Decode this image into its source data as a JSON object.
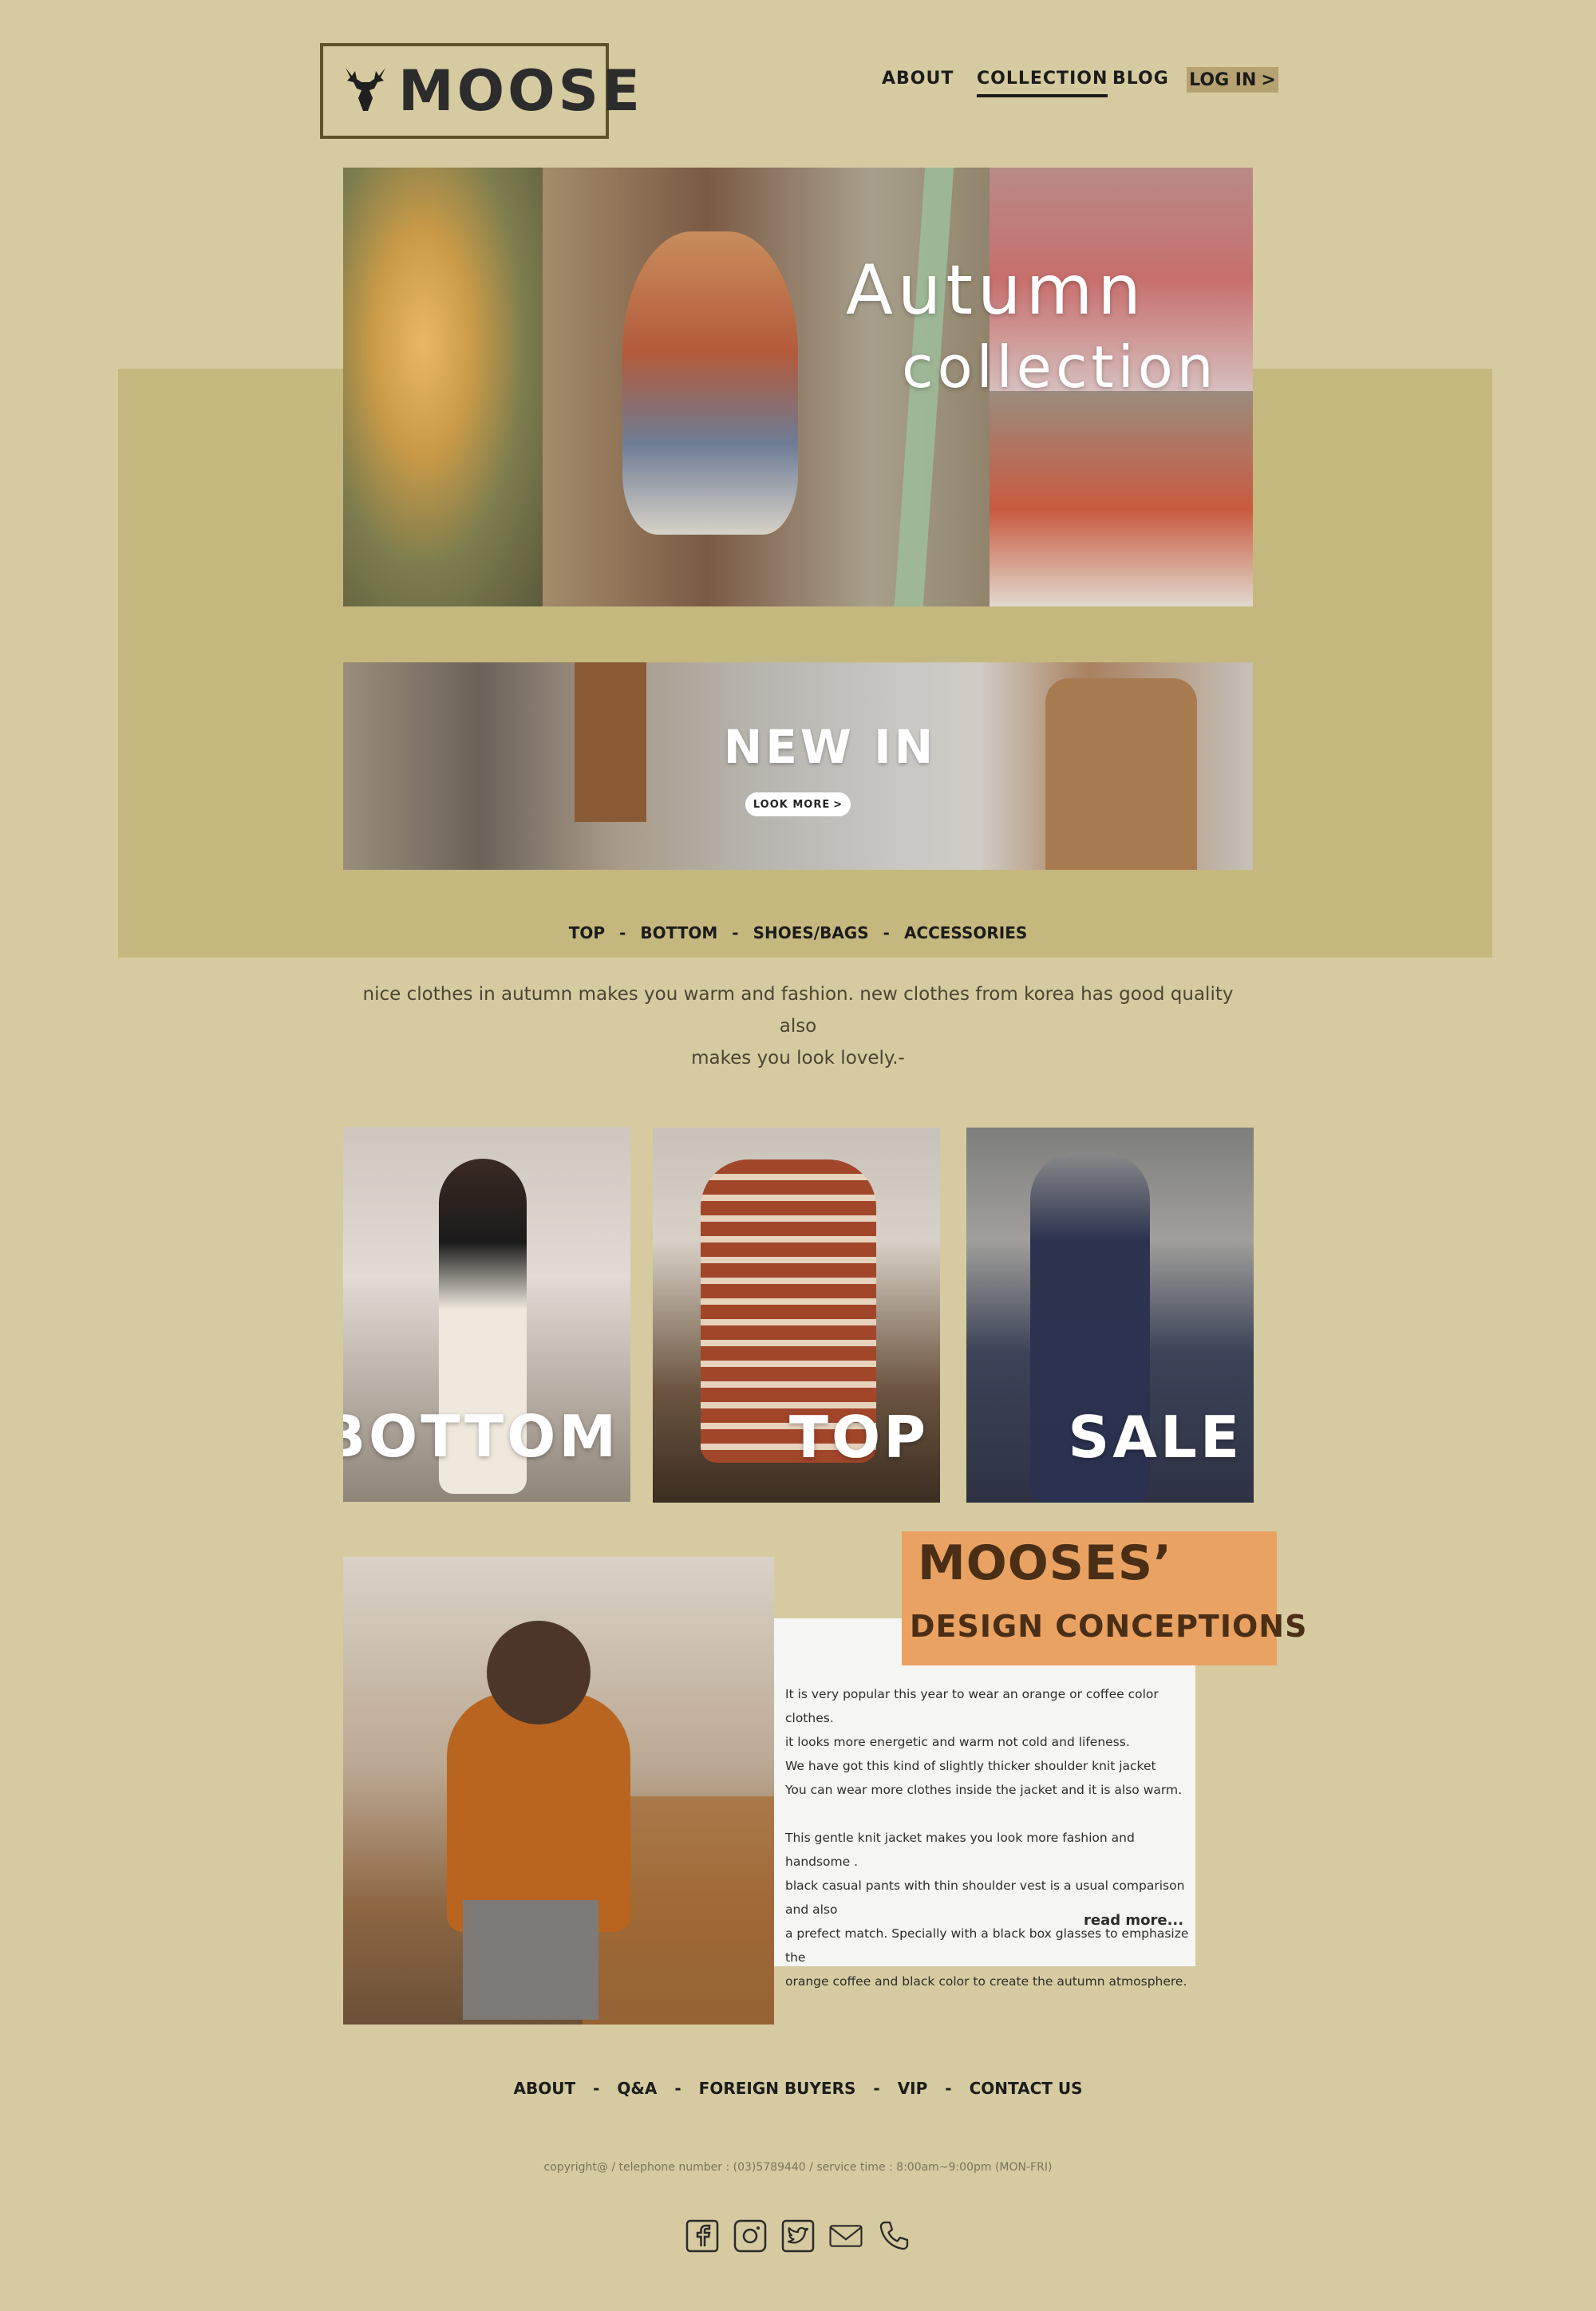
{
  "brand": {
    "name": "MOOSE",
    "logo_icon": "moose-head-icon"
  },
  "nav": {
    "items": [
      {
        "label": "ABOUT"
      },
      {
        "label": "COLLECTION",
        "active": true
      },
      {
        "label": "BLOG"
      }
    ],
    "login": {
      "label": "LOG IN",
      "icon": ">"
    }
  },
  "hero": {
    "line1": "Autumn",
    "line2": "collection"
  },
  "new_in": {
    "title": "NEW  IN",
    "button": "LOOK  MORE",
    "button_icon": ">"
  },
  "categories": {
    "items": [
      "TOP",
      "BOTTOM",
      "SHOES/BAGS",
      "ACCESSORIES"
    ],
    "separator": "-"
  },
  "intro": {
    "line1": "nice clothes in autumn makes you warm and fashion. new clothes from korea has good quality  also",
    "line2": "makes you look lovely.-"
  },
  "tiles": [
    {
      "label": "BOTTOM"
    },
    {
      "label": "TOP"
    },
    {
      "label": "SALE"
    }
  ],
  "concept": {
    "title1": "MOOSES’",
    "title2": "DESIGN  CONCEPTIONS",
    "paragraph1": [
      "It is very popular this year to wear an orange or coffee color clothes.",
      "it looks more energetic and warm not cold and lifeness.",
      "We have got this kind of slightly thicker shoulder knit jacket",
      "You can wear more clothes inside the jacket and it is also warm."
    ],
    "paragraph2": [
      "This gentle knit jacket makes you look more fashion and handsome .",
      "black casual pants with thin shoulder vest is a usual comparison and also",
      "a prefect match. Specially with a black box glasses to emphasize the",
      "orange coffee and black color to create the autumn atmosphere."
    ],
    "read_more": "read more..."
  },
  "footer": {
    "links": [
      "ABOUT",
      "Q&A",
      "FOREIGN BUYERS",
      "VIP",
      "CONTACT US"
    ],
    "separator": "-",
    "copyright": "copyright@ / telephone number : (03)5789440 / service time : 8:00am~9:00pm (MON-FRI)",
    "social_icons": [
      "facebook-icon",
      "instagram-icon",
      "twitter-icon",
      "mail-icon",
      "phone-icon"
    ]
  },
  "colors": {
    "background": "#d6cba0",
    "band": "#c5b87e",
    "accent_badge": "#eaa262",
    "login_bg": "#b5a270"
  }
}
